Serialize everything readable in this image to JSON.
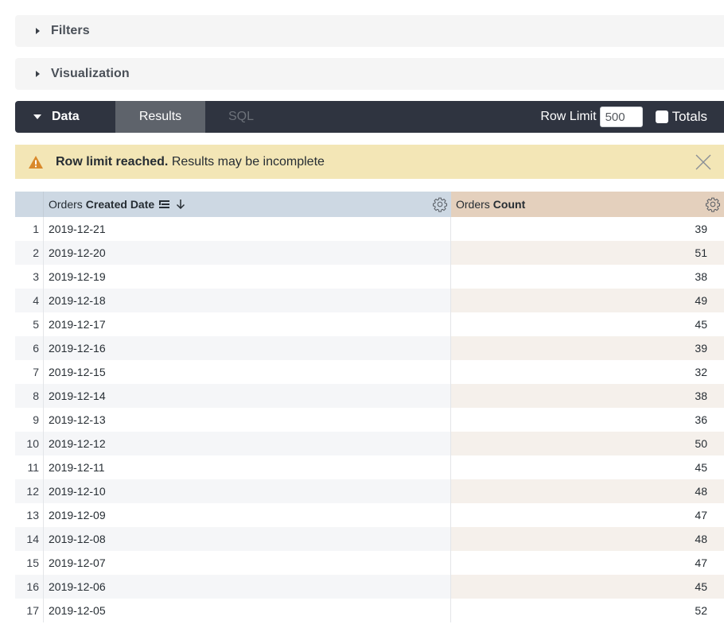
{
  "sections": {
    "filters": "Filters",
    "visualization": "Visualization"
  },
  "data_bar": {
    "data_label": "Data",
    "tabs": [
      {
        "label": "Results",
        "active": true
      },
      {
        "label": "SQL",
        "active": false
      }
    ],
    "row_limit_label": "Row Limit",
    "row_limit_value": "500",
    "totals_label": "Totals",
    "totals_checked": false
  },
  "warning": {
    "bold": "Row limit reached.",
    "text": " Results may be incomplete",
    "color": "#f3e6b6",
    "icon_color": "#d9892b"
  },
  "table": {
    "columns": [
      {
        "view": "Orders",
        "field": "Created Date",
        "type": "dimension",
        "sorted": "desc",
        "color": "#cdd8e3"
      },
      {
        "view": "Orders",
        "field": "Count",
        "type": "measure",
        "color": "#e4d0bd"
      }
    ],
    "rows": [
      {
        "n": "1",
        "date": "2019-12-21",
        "count": "39"
      },
      {
        "n": "2",
        "date": "2019-12-20",
        "count": "51"
      },
      {
        "n": "3",
        "date": "2019-12-19",
        "count": "38"
      },
      {
        "n": "4",
        "date": "2019-12-18",
        "count": "49"
      },
      {
        "n": "5",
        "date": "2019-12-17",
        "count": "45"
      },
      {
        "n": "6",
        "date": "2019-12-16",
        "count": "39"
      },
      {
        "n": "7",
        "date": "2019-12-15",
        "count": "32"
      },
      {
        "n": "8",
        "date": "2019-12-14",
        "count": "38"
      },
      {
        "n": "9",
        "date": "2019-12-13",
        "count": "36"
      },
      {
        "n": "10",
        "date": "2019-12-12",
        "count": "50"
      },
      {
        "n": "11",
        "date": "2019-12-11",
        "count": "45"
      },
      {
        "n": "12",
        "date": "2019-12-10",
        "count": "48"
      },
      {
        "n": "13",
        "date": "2019-12-09",
        "count": "47"
      },
      {
        "n": "14",
        "date": "2019-12-08",
        "count": "48"
      },
      {
        "n": "15",
        "date": "2019-12-07",
        "count": "47"
      },
      {
        "n": "16",
        "date": "2019-12-06",
        "count": "45"
      },
      {
        "n": "17",
        "date": "2019-12-05",
        "count": "52"
      }
    ]
  }
}
